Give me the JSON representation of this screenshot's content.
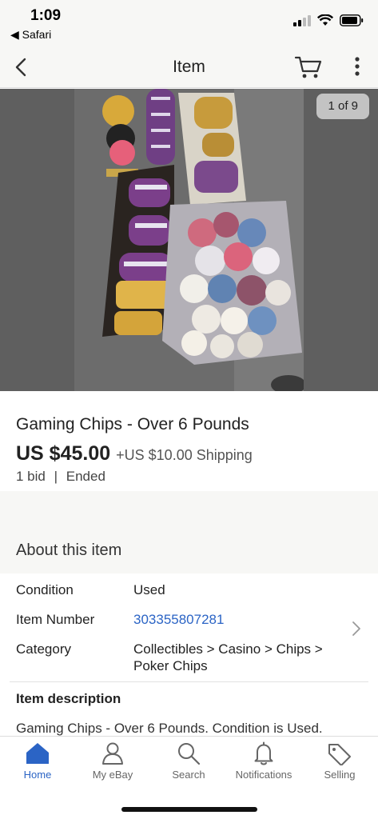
{
  "status_bar": {
    "time": "1:09",
    "back_app": "◀ Safari"
  },
  "nav": {
    "title": "Item"
  },
  "gallery": {
    "counter": "1 of 9"
  },
  "listing": {
    "title": "Gaming Chips - Over 6 Pounds",
    "price": "US $45.00",
    "shipping": "+US $10.00 Shipping",
    "bids": "1 bid",
    "separator": "|",
    "status": "Ended"
  },
  "about": {
    "heading": "About this item",
    "rows": [
      {
        "label": "Condition",
        "value": "Used"
      },
      {
        "label": "Item Number",
        "value": "303355807281"
      },
      {
        "label": "Category",
        "value_line1": "Collectibles > Casino > Chips >",
        "value_line2": "Poker Chips"
      }
    ],
    "description_heading": "Item description",
    "description_text": "Gaming Chips - Over 6 Pounds. Condition is Used."
  },
  "tabs": [
    {
      "label": "Home",
      "icon": "home-icon",
      "active": true
    },
    {
      "label": "My eBay",
      "icon": "person-icon",
      "active": false
    },
    {
      "label": "Search",
      "icon": "search-icon",
      "active": false
    },
    {
      "label": "Notifications",
      "icon": "bell-icon",
      "active": false
    },
    {
      "label": "Selling",
      "icon": "tag-icon",
      "active": false
    }
  ],
  "colors": {
    "accent": "#2b64c5",
    "bar_background": "#f7f7f5"
  }
}
